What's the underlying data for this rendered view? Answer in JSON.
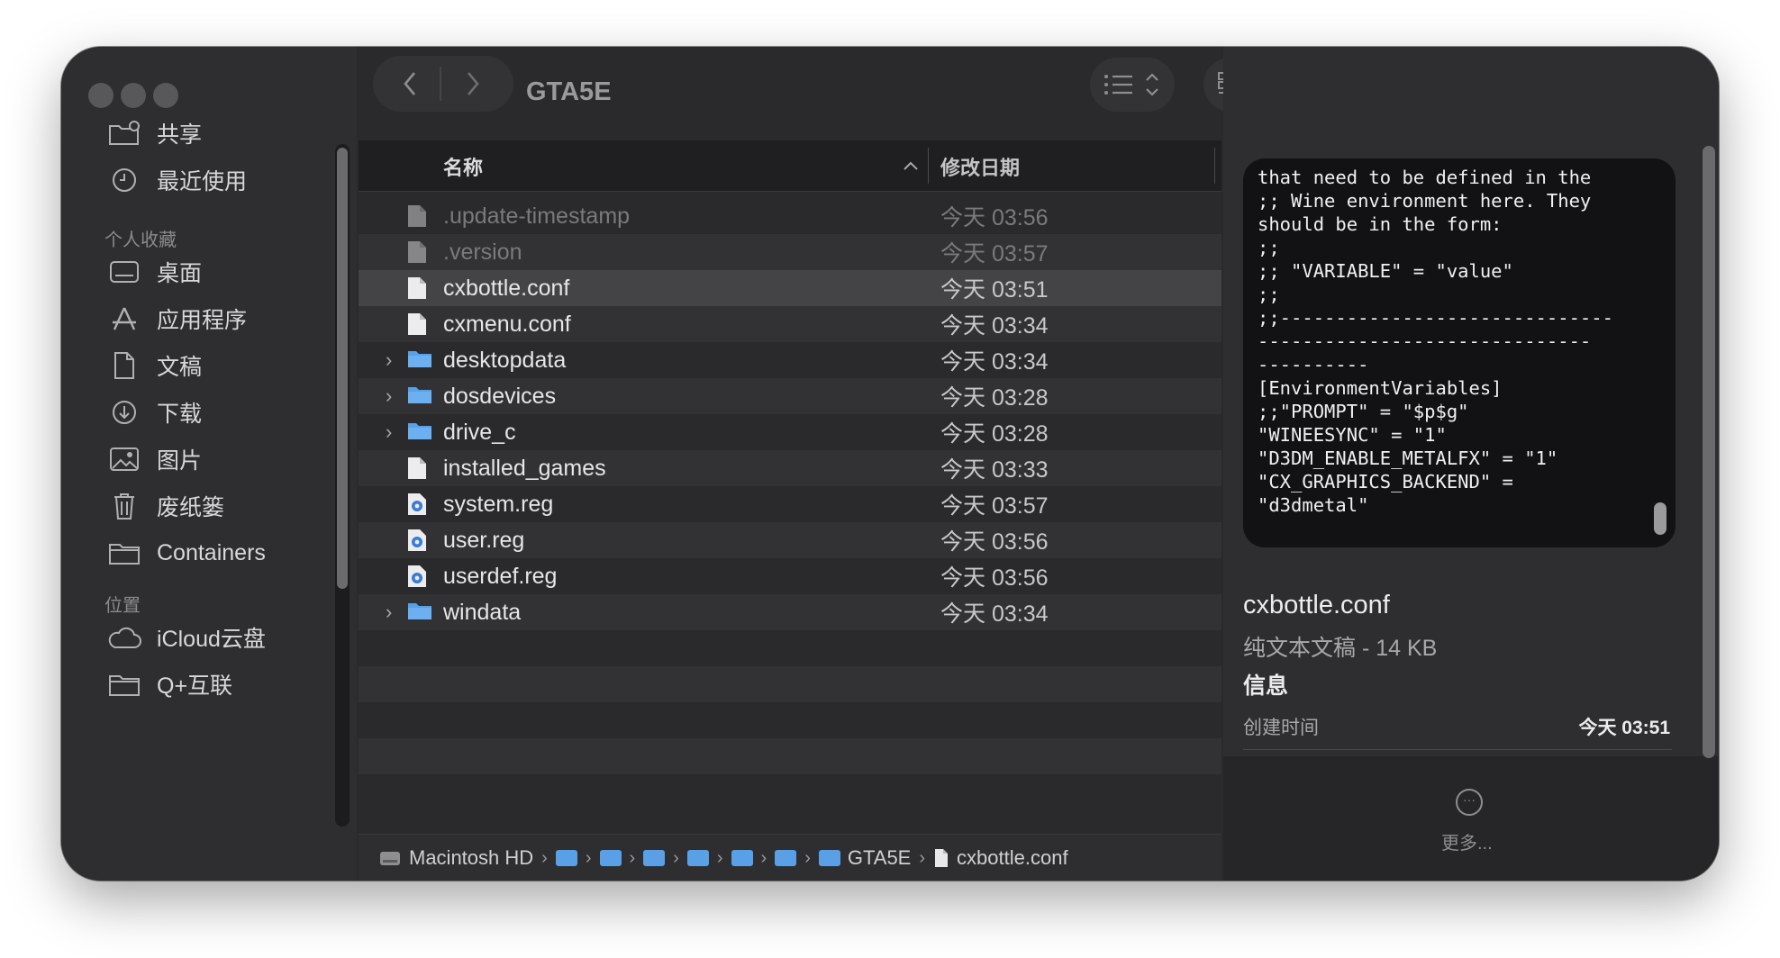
{
  "window": {
    "title": "GTA5E"
  },
  "sidebar": {
    "top_items": [
      {
        "label": "共享",
        "icon": "shared-folder-icon"
      },
      {
        "label": "最近使用",
        "icon": "clock-icon"
      }
    ],
    "sections": [
      {
        "heading": "个人收藏",
        "items": [
          {
            "label": "桌面",
            "icon": "desktop-icon"
          },
          {
            "label": "应用程序",
            "icon": "applications-icon"
          },
          {
            "label": "文稿",
            "icon": "document-icon"
          },
          {
            "label": "下载",
            "icon": "download-icon"
          },
          {
            "label": "图片",
            "icon": "photo-icon"
          },
          {
            "label": "废纸篓",
            "icon": "trash-icon"
          },
          {
            "label": "Containers",
            "icon": "folder-icon"
          }
        ]
      },
      {
        "heading": "位置",
        "items": [
          {
            "label": "iCloud云盘",
            "icon": "cloud-icon"
          },
          {
            "label": "Q+互联",
            "icon": "folder-icon"
          }
        ]
      }
    ]
  },
  "columns": {
    "name": "名称",
    "date": "修改日期"
  },
  "files": [
    {
      "name": ".update-timestamp",
      "date": "今天 03:56",
      "kind": "doc",
      "expandable": false,
      "dimmed": true,
      "selected": false
    },
    {
      "name": ".version",
      "date": "今天 03:57",
      "kind": "doc",
      "expandable": false,
      "dimmed": true,
      "selected": false
    },
    {
      "name": "cxbottle.conf",
      "date": "今天 03:51",
      "kind": "doc",
      "expandable": false,
      "dimmed": false,
      "selected": true
    },
    {
      "name": "cxmenu.conf",
      "date": "今天 03:34",
      "kind": "doc",
      "expandable": false,
      "dimmed": false,
      "selected": false
    },
    {
      "name": "desktopdata",
      "date": "今天 03:34",
      "kind": "folder",
      "expandable": true,
      "dimmed": false,
      "selected": false
    },
    {
      "name": "dosdevices",
      "date": "今天 03:28",
      "kind": "folder",
      "expandable": true,
      "dimmed": false,
      "selected": false
    },
    {
      "name": "drive_c",
      "date": "今天 03:28",
      "kind": "folder",
      "expandable": true,
      "dimmed": false,
      "selected": false
    },
    {
      "name": "installed_games",
      "date": "今天 03:33",
      "kind": "doc",
      "expandable": false,
      "dimmed": false,
      "selected": false
    },
    {
      "name": "system.reg",
      "date": "今天 03:57",
      "kind": "reg",
      "expandable": false,
      "dimmed": false,
      "selected": false
    },
    {
      "name": "user.reg",
      "date": "今天 03:56",
      "kind": "reg",
      "expandable": false,
      "dimmed": false,
      "selected": false
    },
    {
      "name": "userdef.reg",
      "date": "今天 03:56",
      "kind": "reg",
      "expandable": false,
      "dimmed": false,
      "selected": false
    },
    {
      "name": "windata",
      "date": "今天 03:34",
      "kind": "folder",
      "expandable": true,
      "dimmed": false,
      "selected": false
    }
  ],
  "pathbar": {
    "root": "Macintosh HD",
    "intermediate_folder_count": 6,
    "parent": "GTA5E",
    "current": "cxbottle.conf"
  },
  "preview": {
    "content": "that need to be defined in the\n;; Wine environment here. They\nshould be in the form:\n;;\n;; \"VARIABLE\" = \"value\"\n;;\n;;------------------------------\n------------------------------\n----------\n[EnvironmentVariables]\n;;\"PROMPT\" = \"$p$g\"\n\"WINEESYNC\" = \"1\"\n\"D3DM_ENABLE_METALFX\" = \"1\"\n\"CX_GRAPHICS_BACKEND\" =\n\"d3dmetal\"",
    "filename": "cxbottle.conf",
    "kind_size": "纯文本文稿 - 14 KB",
    "info_heading": "信息",
    "created_label": "创建时间",
    "created_value": "今天 03:51",
    "more_label": "更多..."
  },
  "colors": {
    "window_bg": "#2a2a2c",
    "sidebar_bg": "#2e2e30",
    "folder_blue": "#5aa0e6",
    "selected_row": "#444446",
    "accent_blue": "#2f7cf6"
  }
}
